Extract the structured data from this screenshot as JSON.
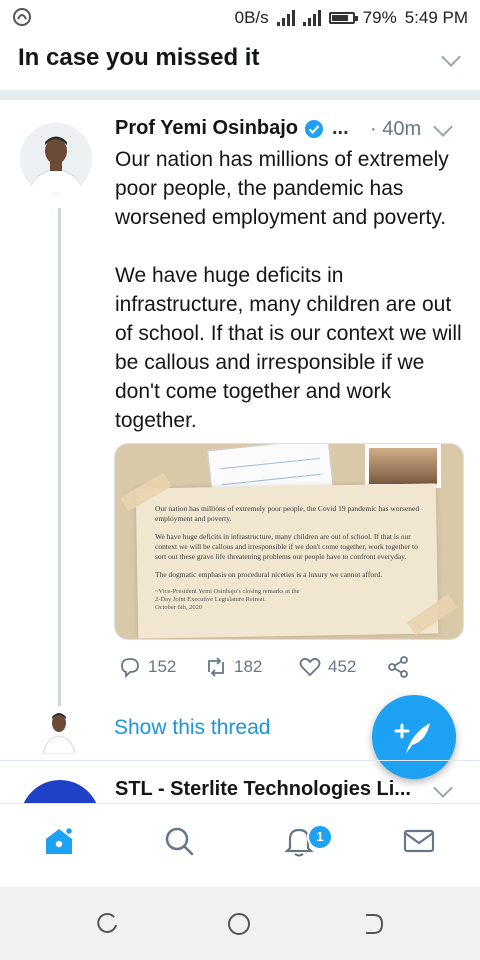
{
  "status": {
    "speed": "0B/s",
    "battery": "79%",
    "time": "5:49 PM",
    "battery_level": 0.79
  },
  "header": {
    "title": "In case you missed it"
  },
  "tweet": {
    "author": "Prof Yemi Osinbajo",
    "ellipsis": "...",
    "time": "· 40m",
    "paragraph1": "Our nation has millions of extremely poor people, the pandemic has worsened employment and poverty.",
    "paragraph2": "We have huge deficits in infrastructure, many children are out of school. If that is our context we will be callous and irresponsible if we don't come together and work together.",
    "media_text": {
      "p1": "Our nation has millions of extremely poor people, the Covid 19 pandemic has worsened employment and poverty.",
      "p2": "We have huge deficits in infrastructure, many children are out of school. If that is our context we will be callous and irresponsible if we don't come together, work together to sort out these grave life threatening problems our people have to confront everyday.",
      "p3": "The dogmatic emphasis on procedural niceties is a luxury we cannot afford.",
      "attribution1": "~Vice-President Yemi Osinbajo's closing remarks at the",
      "attribution2": "2-Day Joint Executive Legislature Retreat.",
      "attribution3": "October 6th, 2020"
    },
    "replies": "152",
    "retweets": "182",
    "likes": "452"
  },
  "thread": {
    "show_label": "Show this thread"
  },
  "next_tweet": {
    "author": "STL - Sterlite Technologies Li..."
  },
  "tabbar": {
    "notifications_badge": "1"
  },
  "icons": [
    "app-icon",
    "signal-icon",
    "battery-icon",
    "verified-badge-icon",
    "chevron-down-icon",
    "reply-icon",
    "retweet-icon",
    "like-icon",
    "share-icon",
    "compose-tweet-icon",
    "home-icon",
    "search-icon",
    "notifications-icon",
    "messages-icon",
    "recent-apps-icon",
    "home-nav-icon",
    "back-icon"
  ],
  "colors": {
    "accent": "#1da1f2",
    "link": "#1b95e0",
    "secondary_text": "#657786"
  }
}
